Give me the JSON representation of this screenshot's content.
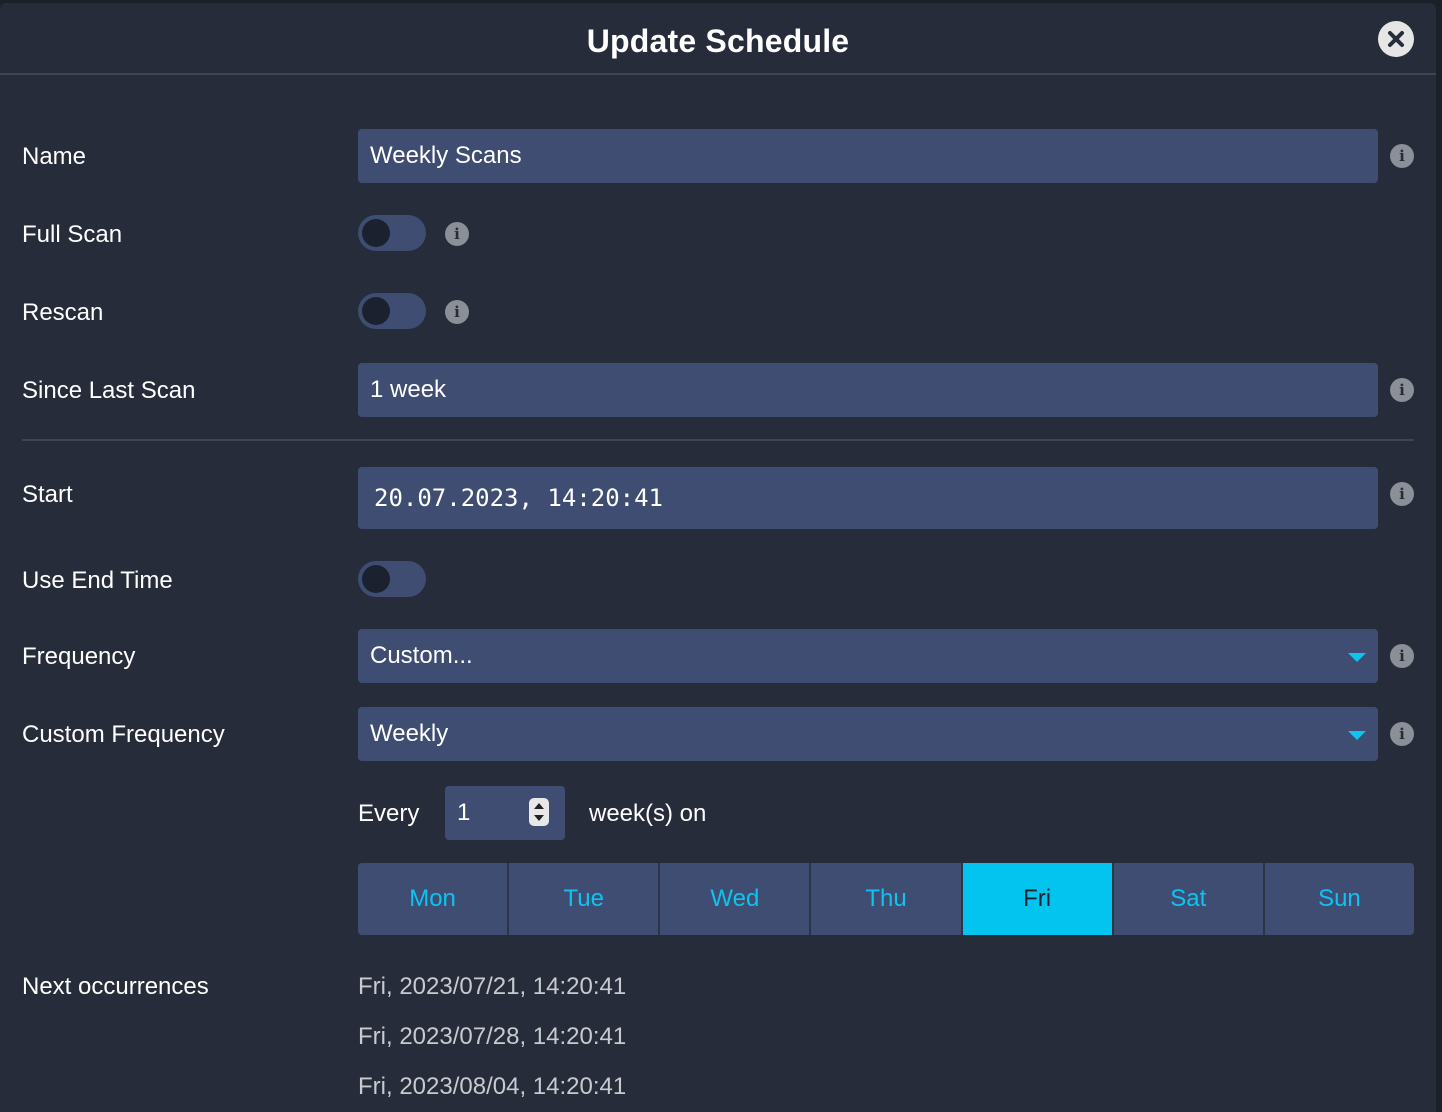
{
  "modal": {
    "title": "Update Schedule"
  },
  "form": {
    "name": {
      "label": "Name",
      "value": "Weekly Scans"
    },
    "full_scan": {
      "label": "Full Scan",
      "on": false
    },
    "rescan": {
      "label": "Rescan",
      "on": false
    },
    "since_last_scan": {
      "label": "Since Last Scan",
      "value": "1 week"
    },
    "start": {
      "label": "Start",
      "value": "20.07.2023, 14:20:41"
    },
    "use_end_time": {
      "label": "Use End Time",
      "on": false
    },
    "frequency": {
      "label": "Frequency",
      "value": "Custom..."
    },
    "custom_frequency": {
      "label": "Custom Frequency",
      "value": "Weekly"
    },
    "every": {
      "prefix": "Every",
      "value": "1",
      "suffix": "week(s) on"
    },
    "days": [
      {
        "label": "Mon",
        "selected": false
      },
      {
        "label": "Tue",
        "selected": false
      },
      {
        "label": "Wed",
        "selected": false
      },
      {
        "label": "Thu",
        "selected": false
      },
      {
        "label": "Fri",
        "selected": true
      },
      {
        "label": "Sat",
        "selected": false
      },
      {
        "label": "Sun",
        "selected": false
      }
    ],
    "next_occurrences": {
      "label": "Next occurrences",
      "items": [
        "Fri, 2023/07/21, 14:20:41",
        "Fri, 2023/07/28, 14:20:41",
        "Fri, 2023/08/04, 14:20:41"
      ]
    }
  },
  "icons": {
    "info": "info-icon",
    "close": "close-icon",
    "dropdown": "chevron-down-icon"
  },
  "colors": {
    "accent": "#03c4ee",
    "field_bg": "#3f4d73",
    "modal_bg": "#262c39"
  }
}
